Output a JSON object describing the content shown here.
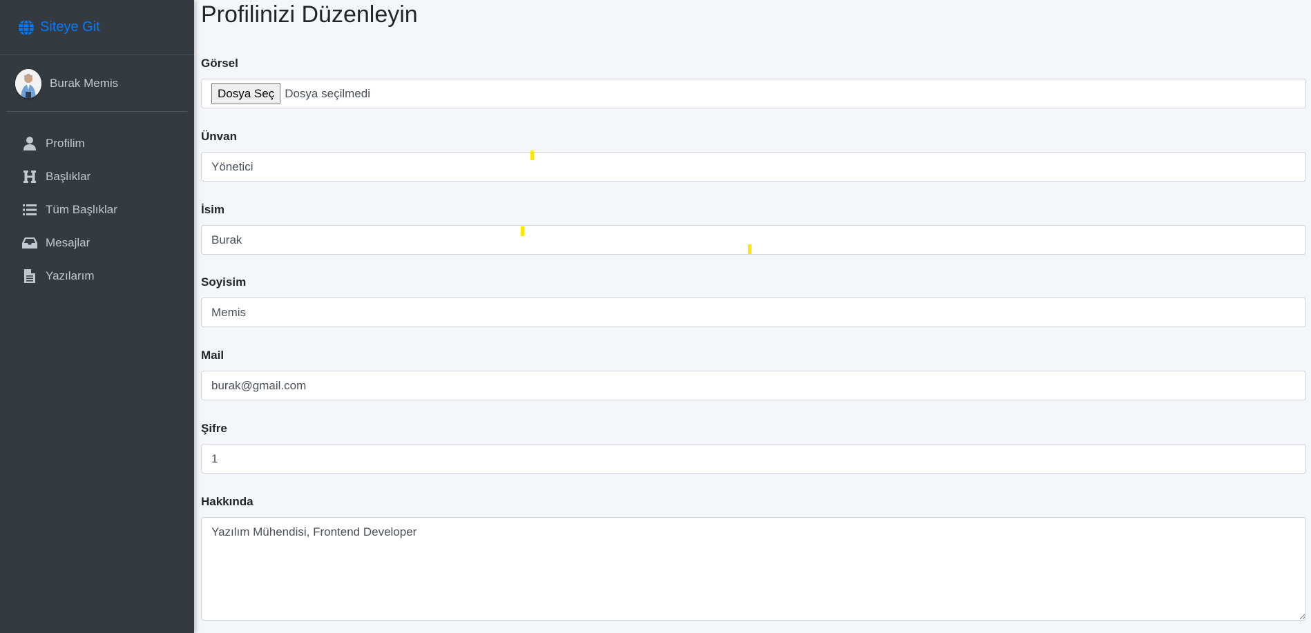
{
  "sidebar": {
    "brand": {
      "label": "Siteye Git",
      "icon": "globe-icon",
      "color": "#007bff"
    },
    "user": {
      "name": "Burak Memis"
    },
    "items": [
      {
        "label": "Profilim",
        "icon": "user-icon"
      },
      {
        "label": "Başlıklar",
        "icon": "heading-icon"
      },
      {
        "label": "Tüm Başlıklar",
        "icon": "list-icon"
      },
      {
        "label": "Mesajlar",
        "icon": "inbox-icon"
      },
      {
        "label": "Yazılarım",
        "icon": "file-icon"
      }
    ]
  },
  "page": {
    "title": "Profilinizi Düzenleyin"
  },
  "form": {
    "image": {
      "label": "Görsel",
      "button": "Dosya Seç",
      "status": "Dosya seçilmedi"
    },
    "title": {
      "label": "Ünvan",
      "value": "Yönetici"
    },
    "first_name": {
      "label": "İsim",
      "value": "Burak"
    },
    "last_name": {
      "label": "Soyisim",
      "value": "Memis"
    },
    "mail": {
      "label": "Mail",
      "value": "burak@gmail.com"
    },
    "password": {
      "label": "Şifre",
      "value": "1"
    },
    "about": {
      "label": "Hakkında",
      "value": "Yazılım Mühendisi, Frontend Developer"
    }
  },
  "colors": {
    "sidebar_bg": "#343a40",
    "content_bg": "#f4f6f9",
    "accent": "#007bff"
  }
}
